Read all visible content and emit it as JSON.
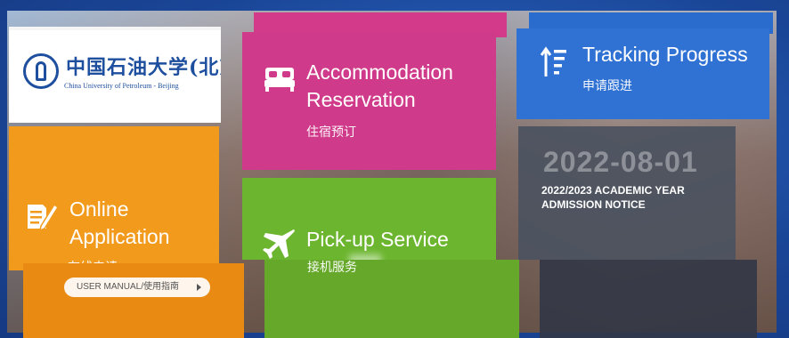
{
  "logo": {
    "name_cn": "中国石油大学(北京)",
    "name_en": "China University of Petroleum - Beijing",
    "seal_icon": "university-seal-icon"
  },
  "tiles": {
    "accommodation": {
      "title_line1": "Accommodation",
      "title_line2": "Reservation",
      "subtitle": "住宿预订",
      "icon": "bed-icon",
      "color": "#d03a8a"
    },
    "tracking": {
      "title": "Tracking Progress",
      "subtitle": "申请跟进",
      "icon": "sort-progress-icon",
      "color": "#2f72d4"
    },
    "online": {
      "title_line1": "Online",
      "title_line2": "Application",
      "subtitle": "在线申请",
      "icon": "edit-document-icon",
      "color": "#f29a1c",
      "manual_button": "USER MANUAL/使用指南"
    },
    "pickup": {
      "title": "Pick-up Service",
      "subtitle": "接机服务",
      "icon": "airplane-icon",
      "color": "#6cb52e"
    },
    "notice": {
      "date": "2022-08-01",
      "text": "2022/2023 ACADEMIC YEAR ADMISSION NOTICE"
    }
  }
}
